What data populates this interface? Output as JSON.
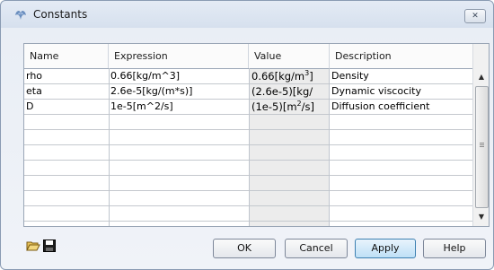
{
  "window": {
    "title": "Constants",
    "close_label": "✕"
  },
  "table": {
    "columns": [
      "Name",
      "Expression",
      "Value",
      "Description"
    ],
    "rows": [
      {
        "name": "rho",
        "expression": "0.66[kg/m^3]",
        "value": "0.66[kg/m",
        "value_sup": "3",
        "value_tail": "]",
        "description": "Density"
      },
      {
        "name": "eta",
        "expression": "2.6e-5[kg/(m*s)]",
        "value": "(2.6e-5)[kg/",
        "value_sup": "",
        "value_tail": "",
        "description": "Dynamic viscocity"
      },
      {
        "name": "D",
        "expression": "1e-5[m^2/s]",
        "value": "(1e-5)[m",
        "value_sup": "2",
        "value_tail": "/s]",
        "description": "Diffusion coefficient"
      }
    ],
    "empty_rows": 7
  },
  "scrollbar": {
    "up_glyph": "▲",
    "down_glyph": "▼"
  },
  "icons": {
    "open": "folder-open-icon",
    "save": "floppy-save-icon"
  },
  "buttons": {
    "ok": "OK",
    "cancel": "Cancel",
    "apply": "Apply",
    "help": "Help"
  },
  "colors": {
    "apply_accent": "#bfe0f6",
    "value_column_shade": "#ececec"
  }
}
